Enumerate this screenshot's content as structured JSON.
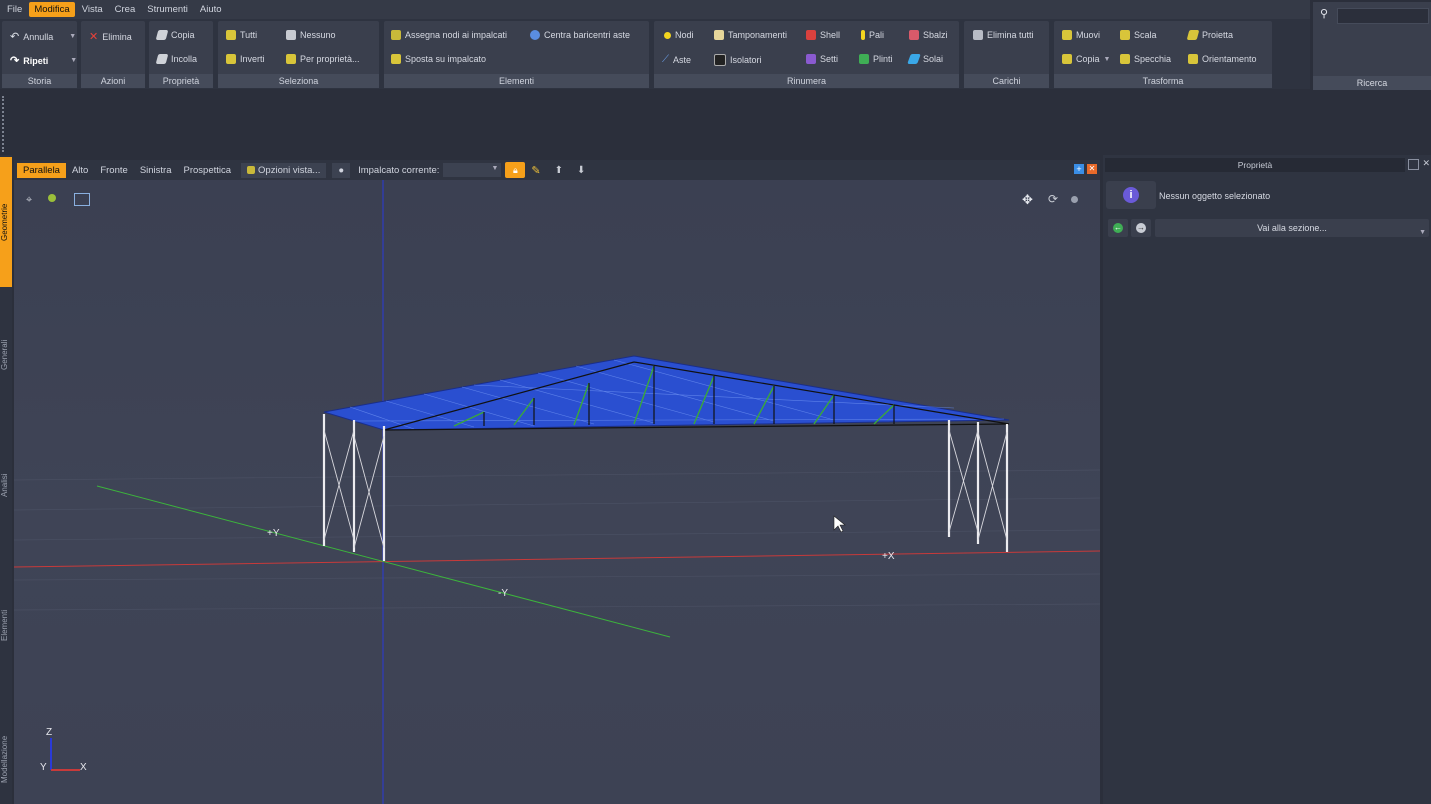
{
  "menubar": {
    "items": [
      "File",
      "Modifica",
      "Vista",
      "Crea",
      "Strumenti",
      "Aiuto"
    ],
    "active_index": 1
  },
  "ribbon": {
    "storia": {
      "label": "Storia",
      "undo": "Annulla",
      "redo": "Ripeti"
    },
    "azioni": {
      "label": "Azioni",
      "delete": "Elimina"
    },
    "proprieta": {
      "label": "Proprietà",
      "copy": "Copia",
      "paste": "Incolla"
    },
    "seleziona": {
      "label": "Seleziona",
      "all": "Tutti",
      "none": "Nessuno",
      "invert": "Inverti",
      "by_property": "Per proprietà..."
    },
    "elementi": {
      "label": "Elementi",
      "assign_nodes": "Assegna nodi ai impalcati",
      "center_bars": "Centra baricentri aste",
      "move_to_floor": "Sposta su impalcato"
    },
    "rinumera": {
      "label": "Rinumera",
      "nodi": "Nodi",
      "tamponamenti": "Tamponamenti",
      "shell": "Shell",
      "pali": "Pali",
      "sbalzi": "Sbalzi",
      "aste": "Aste",
      "isolatori": "Isolatori",
      "setti": "Setti",
      "plinti": "Plinti",
      "solai": "Solai"
    },
    "carichi": {
      "label": "Carichi",
      "delete_all": "Elimina tutti"
    },
    "trasforma": {
      "label": "Trasforma",
      "muovi": "Muovi",
      "scala": "Scala",
      "proietta": "Proietta",
      "copia": "Copia",
      "specchia": "Specchia",
      "orientamento": "Orientamento"
    }
  },
  "search": {
    "label": "Ricerca"
  },
  "sidebar": {
    "tabs": [
      "Geometrie",
      "Generali",
      "Analisi",
      "Elementi",
      "Modellazione"
    ],
    "active_index": 0
  },
  "viewport": {
    "views": [
      "Parallela",
      "Alto",
      "Fronte",
      "Sinistra",
      "Prospettica"
    ],
    "active_view": 0,
    "options": "Opzioni vista...",
    "floor_label": "Impalcato corrente:",
    "axis_plus_y": "+Y",
    "axis_minus_y": "-Y",
    "axis_plus_x": "+X",
    "triad": {
      "z": "Z",
      "y": "Y",
      "x": "X"
    }
  },
  "properties": {
    "title": "Proprietà",
    "empty_message": "Nessun oggetto selezionato",
    "goto_section": "Vai alla sezione..."
  },
  "colors": {
    "accent": "#f6a01a",
    "x_axis": "#e03030",
    "y_axis": "#3cb43c",
    "z_axis": "#2a3ad8",
    "roof": "#2a4fd0"
  }
}
